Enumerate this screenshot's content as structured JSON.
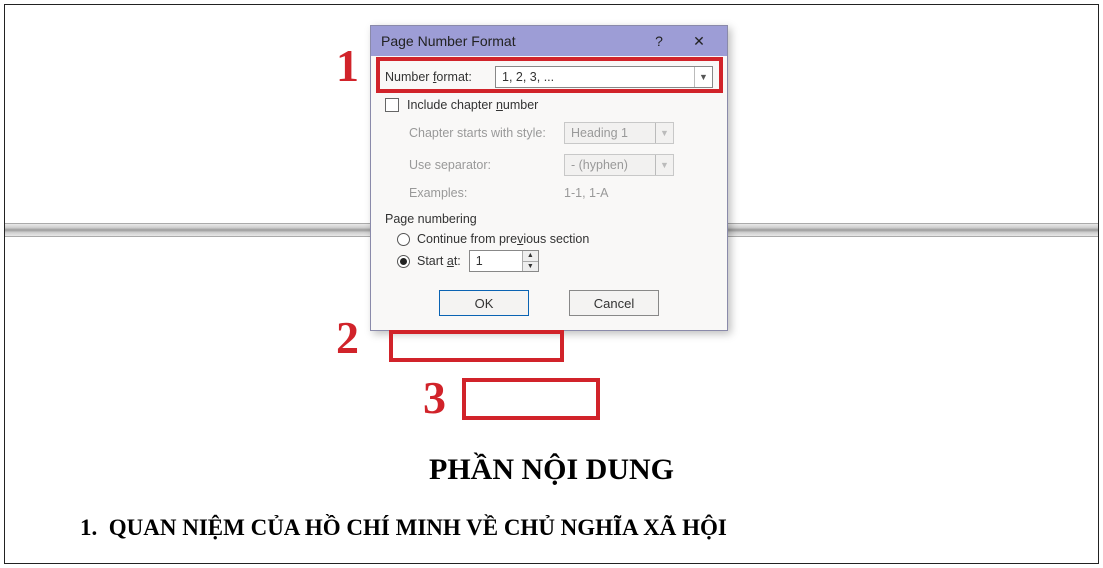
{
  "dialog": {
    "title": "Page Number Format",
    "help_symbol": "?",
    "close_symbol": "✕",
    "number_format_label_pre": "Number ",
    "number_format_label_u": "f",
    "number_format_label_post": "ormat:",
    "number_format_value": "1, 2, 3, ...",
    "include_chapter_pre": "Include chapter ",
    "include_chapter_u": "n",
    "include_chapter_post": "umber",
    "chapter_starts_label": "Chapter starts with style:",
    "chapter_starts_value": "Heading 1",
    "use_separator_label": "Use separator:",
    "use_separator_value": "-   (hyphen)",
    "examples_label": "Examples:",
    "examples_value": "1-1, 1-A",
    "group_label": "Page numbering",
    "continue_pre": "Continue from pre",
    "continue_u": "v",
    "continue_post": "ious section",
    "start_at_pre": "Start ",
    "start_at_u": "a",
    "start_at_post": "t:",
    "start_at_value": "1",
    "ok": "OK",
    "cancel": "Cancel"
  },
  "callouts": {
    "n1": "1",
    "n2": "2",
    "n3": "3"
  },
  "document": {
    "title": "PHẦN NỘI DUNG",
    "heading_num": "1.",
    "heading_text": "QUAN NIỆM CỦA HỒ CHÍ MINH VỀ CHỦ NGHĨA XÃ HỘI"
  }
}
